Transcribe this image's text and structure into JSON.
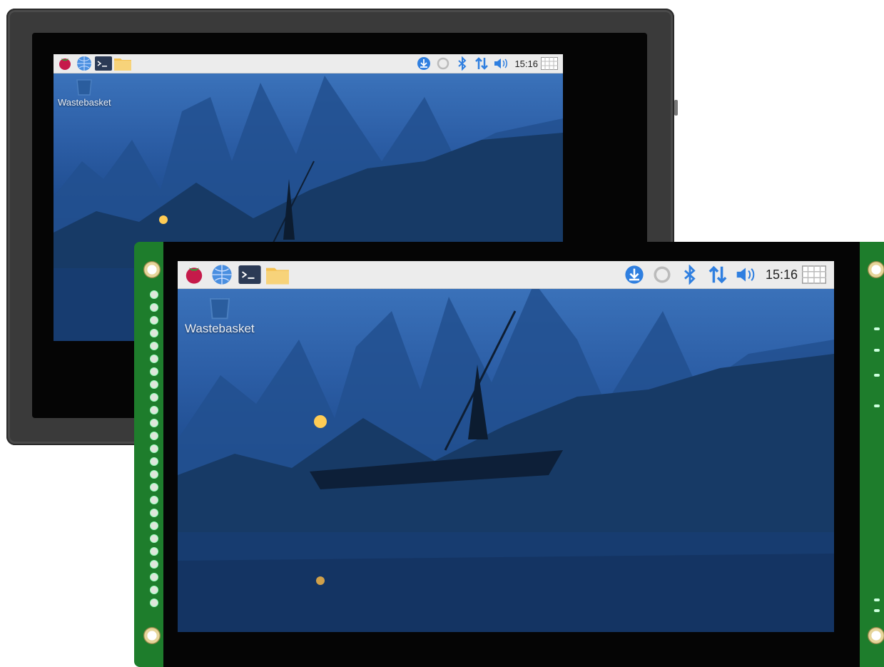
{
  "taskbar": {
    "launchers": [
      {
        "icon": "raspberry-menu-icon"
      },
      {
        "icon": "web-browser-icon"
      },
      {
        "icon": "terminal-icon"
      },
      {
        "icon": "file-manager-icon"
      }
    ],
    "tray": [
      {
        "icon": "download-updates-icon"
      },
      {
        "icon": "sync-icon"
      },
      {
        "icon": "bluetooth-icon"
      },
      {
        "icon": "network-icon"
      },
      {
        "icon": "volume-icon"
      }
    ],
    "clock": "15:16",
    "keyboard_icon": "virtual-keyboard-icon"
  },
  "desktop": {
    "icons": [
      {
        "label": "Wastebasket",
        "icon": "trash-icon"
      }
    ],
    "wallpaper": "fisherman-on-river-at-dusk"
  },
  "colors": {
    "pcb": "#1e7d2c",
    "bezel": "#3a3a3a",
    "taskbar": "#ececec",
    "sky": "#3f78c0",
    "tray_blue": "#2f7fe0"
  }
}
